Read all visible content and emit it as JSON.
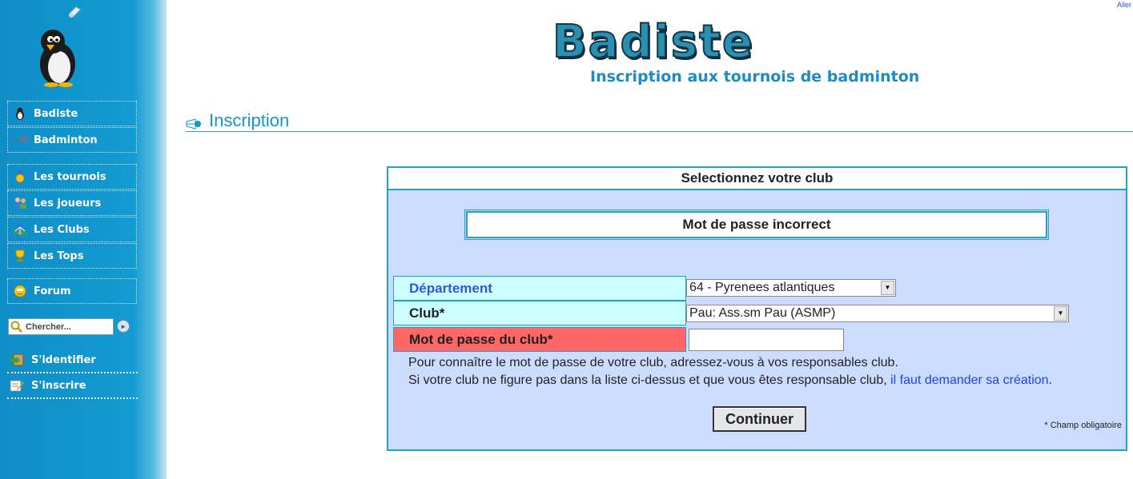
{
  "sidebar": {
    "nav_group_1": [
      {
        "label": "Badiste",
        "icon": "penguin-icon"
      },
      {
        "label": "Badminton",
        "icon": "racket-icon"
      }
    ],
    "nav_group_2": [
      {
        "label": "Les tournois",
        "icon": "medal-icon"
      },
      {
        "label": "Les joueurs",
        "icon": "players-icon"
      },
      {
        "label": "Les Clubs",
        "icon": "clubs-icon"
      },
      {
        "label": "Les Tops",
        "icon": "trophy-icon"
      }
    ],
    "nav_group_3": [
      {
        "label": "Forum",
        "icon": "smiley-icon"
      }
    ],
    "search": {
      "placeholder": "Chercher..."
    },
    "auth": [
      {
        "label": "S'identifier",
        "icon": "login-icon"
      },
      {
        "label": "S'inscrire",
        "icon": "register-icon"
      }
    ]
  },
  "header": {
    "top_link": "Aller",
    "logo_title": "Badiste",
    "logo_subtitle": "Inscription aux tournois de badminton"
  },
  "page": {
    "heading": "Inscription"
  },
  "form": {
    "title": "Selectionnez votre club",
    "error": "Mot de passe incorrect",
    "fields": {
      "departement_label": "Département",
      "departement_value": "64 - Pyrenees atlantiques",
      "club_label": "Club*",
      "club_value": "Pau: Ass.sm Pau (ASMP)",
      "password_label": "Mot de passe du club*",
      "password_value": ""
    },
    "info_line_1": "Pour connaître le mot de passe de votre club, adressez-vous à vos responsables club.",
    "info_line_2": "Si votre club ne figure pas dans la liste ci-dessus et que vous êtes responsable club,",
    "info_link": "il faut demander sa création",
    "info_end": ".",
    "submit_label": "Continuer",
    "required_note": "* Champ obligatoire"
  },
  "colors": {
    "sidebar": "#129bd2",
    "panel_bg": "#ccdcff",
    "border": "#2aa0c0",
    "field_label_bg": "#ccffff",
    "error_label_bg": "#ff6666",
    "link": "#2244dd"
  }
}
